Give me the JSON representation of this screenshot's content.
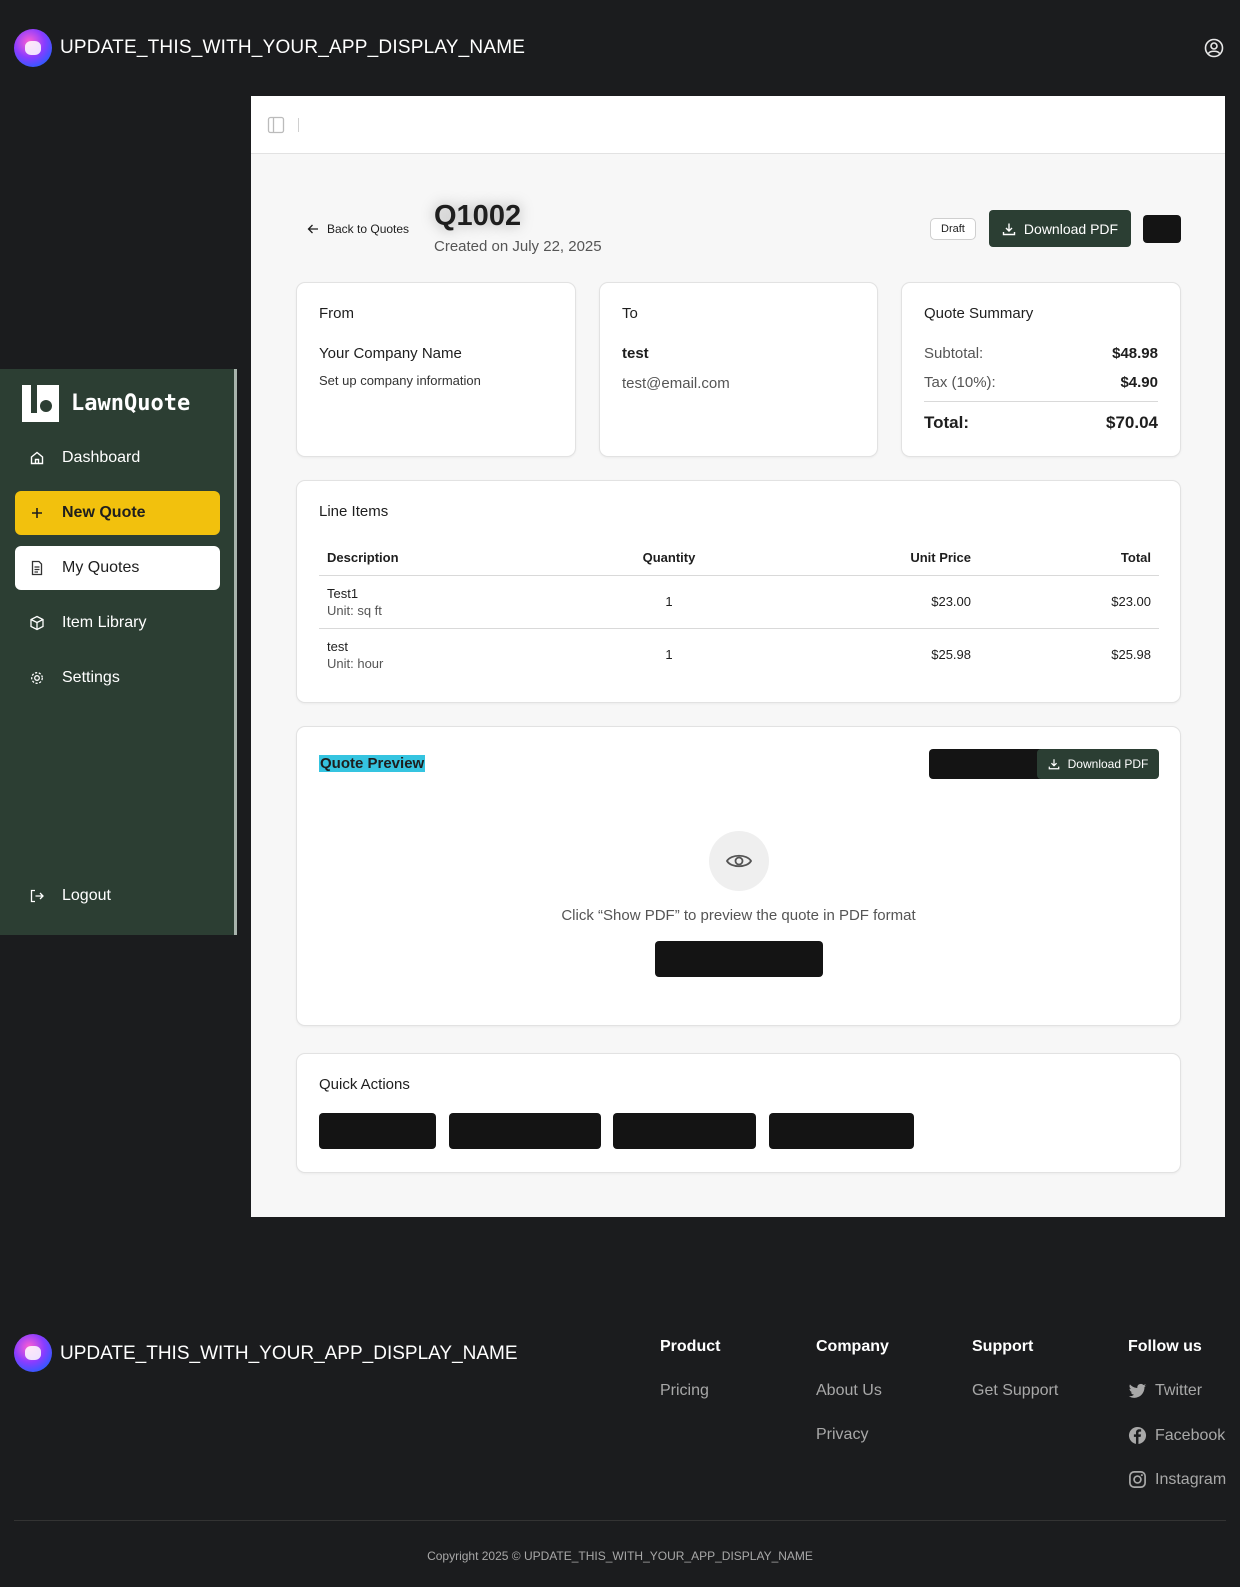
{
  "header": {
    "app_name": "UPDATE_THIS_WITH_YOUR_APP_DISPLAY_NAME"
  },
  "sidebar": {
    "brand": "LawnQuote",
    "items": [
      {
        "label": "Dashboard",
        "icon": "home-icon"
      },
      {
        "label": "New Quote",
        "icon": "plus-icon"
      },
      {
        "label": "My Quotes",
        "icon": "document-icon"
      },
      {
        "label": "Item Library",
        "icon": "package-icon"
      },
      {
        "label": "Settings",
        "icon": "gear-icon"
      }
    ],
    "logout": "Logout"
  },
  "quote": {
    "back": "Back to Quotes",
    "id": "Q1002",
    "created": "Created on July 22, 2025",
    "status": "Draft",
    "download_label": "Download PDF"
  },
  "from": {
    "title": "From",
    "company": "Your Company Name",
    "note": "Set up company information"
  },
  "to": {
    "title": "To",
    "name": "test",
    "email": "test@email.com"
  },
  "summary": {
    "title": "Quote Summary",
    "subtotal_label": "Subtotal:",
    "subtotal": "$48.98",
    "tax_label": "Tax (10%):",
    "tax": "$4.90",
    "total_label": "Total:",
    "total": "$70.04"
  },
  "line_items": {
    "title": "Line Items",
    "headers": [
      "Description",
      "Quantity",
      "Unit Price",
      "Total"
    ],
    "rows": [
      {
        "name": "Test1",
        "unit": "Unit: sq ft",
        "qty": "1",
        "price": "$23.00",
        "total": "$23.00"
      },
      {
        "name": "test",
        "unit": "Unit: hour",
        "qty": "1",
        "price": "$25.98",
        "total": "$25.98"
      }
    ]
  },
  "preview": {
    "title": "Quote Preview",
    "download_label": "Download PDF",
    "message": "Click “Show PDF” to preview the quote in PDF format"
  },
  "quick_actions": {
    "title": "Quick Actions"
  },
  "footer": {
    "app_name": "UPDATE_THIS_WITH_YOUR_APP_DISPLAY_NAME",
    "product": {
      "title": "Product",
      "links": [
        "Pricing"
      ]
    },
    "company": {
      "title": "Company",
      "links": [
        "About Us",
        "Privacy"
      ]
    },
    "support": {
      "title": "Support",
      "links": [
        "Get Support"
      ]
    },
    "follow": {
      "title": "Follow us",
      "links": [
        "Twitter",
        "Facebook",
        "Instagram"
      ]
    },
    "copyright": "Copyright 2025 © UPDATE_THIS_WITH_YOUR_APP_DISPLAY_NAME"
  },
  "colors": {
    "sidebar_bg": "#2c3e33",
    "accent_yellow": "#f2c10d",
    "primary_dark": "#2b3e33",
    "highlight": "#35c4e0"
  }
}
